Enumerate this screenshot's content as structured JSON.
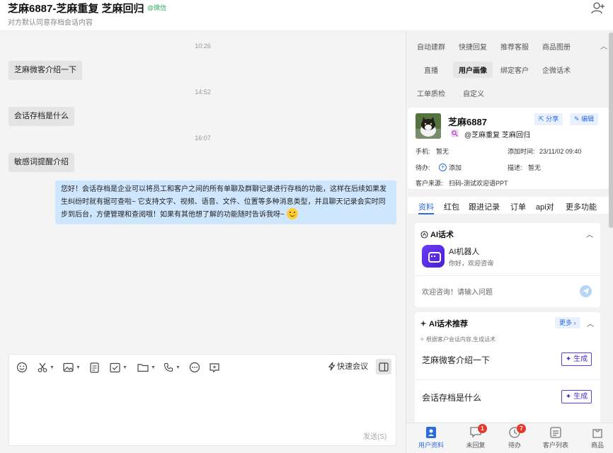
{
  "header": {
    "title": "芝麻6887-芝麻重复 芝麻回归",
    "tag": "@微信",
    "subtitle": "对方默认同意存档会话内容"
  },
  "chat": {
    "times": [
      "10:26",
      "14:52",
      "16:07"
    ],
    "incoming": [
      "芝麻微客介绍一下",
      "会话存档是什么",
      "敏感词提醒介绍"
    ],
    "reply": "您好！会话存档是企业可以将员工和客户之间的所有单聊及群聊记录进行存档的功能，这样在后续如果发生纠纷时就有据可查啦~ 它支持文字、视频、语音、文件、位置等多种消息类型，并且聊天记录会实时同步到后台，方便管理和查阅哦！如果有其他想了解的功能随时告诉我呀~"
  },
  "composer": {
    "quick_meeting": "快速会议",
    "send": "发送(S)"
  },
  "side": {
    "tabs_row1": [
      "自动建群",
      "快捷回复",
      "推荐客服",
      "商品图册"
    ],
    "tabs_row2": [
      "直播",
      "用户画像",
      "绑定客户",
      "企微话术"
    ],
    "tabs_row3": [
      "工单质检",
      "自定义"
    ],
    "customer": {
      "name": "芝麻6887",
      "share": "分享",
      "edit": "编辑",
      "corp": "@芝麻重复 芝麻回归",
      "phone_label": "手机:",
      "phone": "暂无",
      "added_label": "添加时间:",
      "added": "23/11/02 09:40",
      "todo_label": "待办:",
      "todo_add": "添加",
      "desc_label": "描述:",
      "desc": "暂无",
      "source_label": "客户来源:",
      "source": "扫码-测试欢迎语PPT"
    },
    "profile_tabs": [
      "资料",
      "红包",
      "跟进记录",
      "订单",
      "api对",
      "更多功能"
    ],
    "ai_script": {
      "title": "AI话术",
      "bot_name": "AI机器人",
      "bot_sub": "你好，欢迎咨询",
      "placeholder": "欢迎咨询！请输入问题"
    },
    "ai_recommend": {
      "title": "AI话术推荐",
      "more": "更多",
      "hint": "根据客户会话内容,生成话术",
      "items": [
        "芝麻微客介绍一下",
        "会话存档是什么"
      ],
      "generate": "生成"
    },
    "bottom_nav": [
      {
        "label": "用户资料",
        "icon": "user-profile-icon"
      },
      {
        "label": "未回复",
        "icon": "unreplied-icon",
        "badge": "1"
      },
      {
        "label": "待办",
        "icon": "todo-icon",
        "badge": "7"
      },
      {
        "label": "客户列表",
        "icon": "customer-list-icon"
      },
      {
        "label": "商品",
        "icon": "goods-icon"
      }
    ]
  },
  "colors": {
    "accent": "#2c6ce0",
    "reply_bubble": "#cfe6ff",
    "incoming_bubble": "#e4e4e4",
    "ai_purple": "#4a2fd6",
    "badge": "#e23b2e"
  }
}
